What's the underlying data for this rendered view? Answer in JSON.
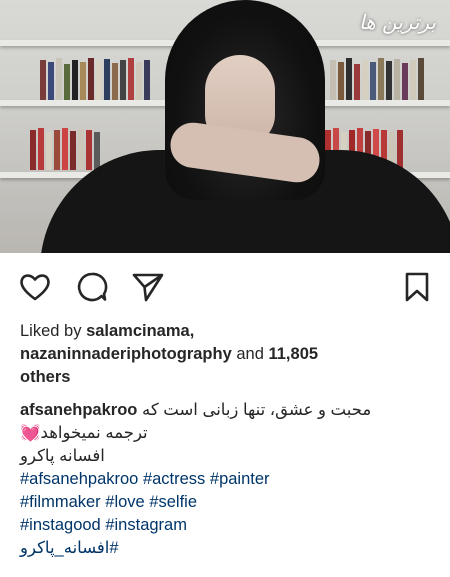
{
  "photo": {
    "description_icon": "selfie-photo",
    "watermark": "برترین ها"
  },
  "actions": {
    "like_icon": "heart-icon",
    "comment_icon": "comment-icon",
    "share_icon": "paper-plane-icon",
    "save_icon": "bookmark-icon"
  },
  "likes": {
    "prefix": "Liked by",
    "user1": "salamcinama,",
    "user2": "nazaninnaderiphotography",
    "connector": "and",
    "count": "11,805",
    "suffix": "others"
  },
  "caption": {
    "username": "afsanehpakroo",
    "line1_text": "محبت و عشق، تنها زبانی است که",
    "line2_text": "ترجمه نمیخواهد💓",
    "line3_text": "افسانه پاکرو",
    "hashtags_row1": [
      "#afsanehpakroo",
      "#actress",
      "#painter"
    ],
    "hashtags_row2": [
      "#filmmaker",
      "#love",
      "#selfie"
    ],
    "hashtags_row3": [
      "#instagood",
      "#instagram"
    ],
    "hashtags_row4": [
      "#افسانه_پاکرو"
    ]
  },
  "colors": {
    "text": "#262626",
    "hashtag": "#003569"
  }
}
